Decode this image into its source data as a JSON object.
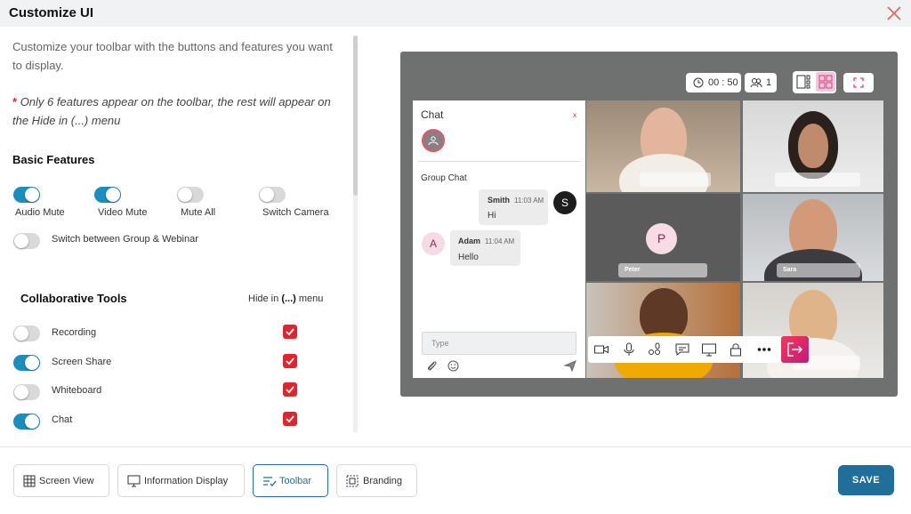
{
  "window": {
    "title": "Customize UI"
  },
  "left": {
    "intro": "Customize your toolbar with the buttons and features you want to display.",
    "note_star": "*",
    "note": "Only 6 features appear on the toolbar, the rest will appear on the Hide in (...) menu",
    "basic": {
      "heading": "Basic Features",
      "items": [
        {
          "label": "Audio Mute",
          "on": true
        },
        {
          "label": "Video Mute",
          "on": true
        },
        {
          "label": "Mute All",
          "on": false
        },
        {
          "label": "Switch Camera",
          "on": false
        },
        {
          "label": "Switch between Group & Webinar",
          "on": false
        }
      ]
    },
    "collab": {
      "heading": "Collaborative Tools",
      "hide_prefix": "Hide in",
      "hide_bold": "(...)",
      "hide_suffix": "menu",
      "items": [
        {
          "label": "Recording",
          "on": false,
          "hide": true
        },
        {
          "label": "Screen Share",
          "on": true,
          "hide": true
        },
        {
          "label": "Whiteboard",
          "on": false,
          "hide": true
        },
        {
          "label": "Chat",
          "on": true,
          "hide": true
        }
      ]
    }
  },
  "preview": {
    "timer": "00 : 50",
    "participants": "1",
    "chat": {
      "title": "Chat",
      "close": "x",
      "group_label": "Group Chat",
      "messages": [
        {
          "name": "Smith",
          "time": "11:03 AM",
          "text": "Hi",
          "avatar": "S"
        },
        {
          "name": "Adam",
          "time": "11:04 AM",
          "text": "Hello",
          "avatar": "A"
        }
      ],
      "placeholder": "Type"
    },
    "tiles": {
      "avatar_letter": "P",
      "name_peter": "Peter",
      "name_sara": "Sara"
    }
  },
  "footer": {
    "tabs": [
      {
        "label": "Screen View",
        "icon": "grid-icon"
      },
      {
        "label": "Information Display",
        "icon": "monitor-icon"
      },
      {
        "label": "Toolbar",
        "icon": "toolbar-icon"
      },
      {
        "label": "Branding",
        "icon": "branding-icon"
      }
    ],
    "active_tab": "Toolbar",
    "save": "SAVE"
  },
  "colors": {
    "accent": "#1f6f9a",
    "toggle_on": "#1b8dbe",
    "danger": "#e0262c"
  }
}
